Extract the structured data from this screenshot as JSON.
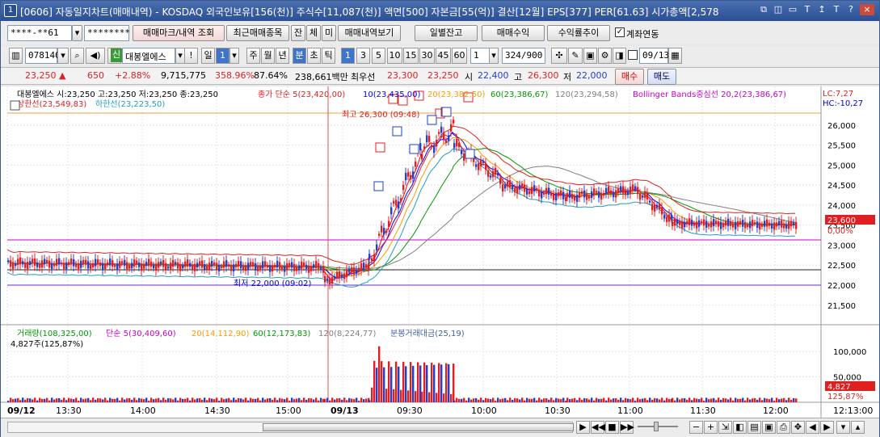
{
  "titlebar": {
    "num": "1",
    "text": "[0606] 자동일지차트(매매내역) - KOSDAQ 외국인보유[156(천)] 주식수[11,087(천)] 액면[500] 자본금[55(억)] 결산[12월] EPS[377] PER[61.63] 시가총액[2,578",
    "icons": [
      "⧉",
      "◫",
      "▭",
      "T",
      "↥",
      "T",
      "?"
    ],
    "close": "×"
  },
  "row1": {
    "account": "****-**61",
    "password": "********",
    "btn_trade": "매매마크/내역 조회",
    "btn_recent": "최근매매종목",
    "t1": "잔",
    "t2": "체",
    "t3": "미",
    "btn_view": "매매내역보기",
    "btn_daily": "일별잔고",
    "btn_profit": "매매수익",
    "btn_return": "수익률추이",
    "chk_label": "계좌연동"
  },
  "row2": {
    "code": "078140",
    "tag": "신",
    "name": "대봉엘에스",
    "ex": "!",
    "day": "일",
    "day_n": "1",
    "u1": "주",
    "u2": "월",
    "u3": "년",
    "u4": "분",
    "u5": "초",
    "u6": "틱",
    "mins": [
      "1",
      "3",
      "5",
      "10",
      "15",
      "30",
      "45",
      "60"
    ],
    "count": "1",
    "range": "324/900",
    "date": "09/13"
  },
  "quote": {
    "price": "23,250",
    "arrow": "▲",
    "change": "650",
    "pct": "+2.88%",
    "volume": "9,715,775",
    "vol_ratio": "358.96%",
    "turn": "87.64%",
    "amount": "238,661백만",
    "best_label": "최우선",
    "ask": "23,300",
    "bid": "23,250",
    "open_l": "시",
    "open": "22,400",
    "high_l": "고",
    "high": "26,300",
    "low_l": "저",
    "low": "22,000",
    "buy": "매수",
    "sell": "매도"
  },
  "chart_legend": {
    "name": "대봉엘에스 시:23,250 고:23,250 저:23,250 종:23,250",
    "ma_title": "종가 단순 5(23,420,00)",
    "ma10": "10(23,435,00)",
    "ma20": "20(23,382,50)",
    "ma60": "60(23,386,67)",
    "ma120": "120(23,294,58)",
    "bb": "Bollinger Bands중심선 20,2(23,386,67)",
    "upper": "상한선(23,549,83)",
    "lower": "하한선(23,223,50)",
    "lc": "LC:7,27",
    "hc": "HC:-10,27",
    "high_note": "최고 26,300 (09:48)",
    "low_note": "최저 22,000 (09:02)",
    "price_tag": "23,600",
    "pct_tag": "0,00%"
  },
  "volume_legend": {
    "title": "거래량(108,325,00)",
    "ma5": "단순 5(30,409,60)",
    "ma20": "20(14,112,90)",
    "ma60": "60(12,173,83)",
    "ma120": "120(8,224,77)",
    "amt": "분봉거래대금(25,19)",
    "now": "4,827주(125,87%)",
    "tag1": "4,827",
    "tag2": "125,87%"
  },
  "price_axis": [
    "26,000",
    "25,500",
    "25,000",
    "24,500",
    "24,000",
    "23,500",
    "23,000",
    "22,500",
    "22,000",
    "21,500"
  ],
  "volume_axis": [
    "100,000",
    "50,000"
  ],
  "x_axis": [
    "09/12",
    "13:30",
    "14:00",
    "14:30",
    "15:00",
    "09/13",
    "09:30",
    "10:00",
    "10:30",
    "11:00",
    "11:30",
    "12:00",
    "12:13:00"
  ],
  "markers": {
    "b": "B",
    "s": "S"
  },
  "colors": {
    "up": "#e02020",
    "down": "#2040c8",
    "ma5": "#ff0000",
    "ma10": "#0000ff",
    "ma20": "#ff9900",
    "ma60": "#009900",
    "ma120": "#808080",
    "bb": "#cc00cc"
  }
}
